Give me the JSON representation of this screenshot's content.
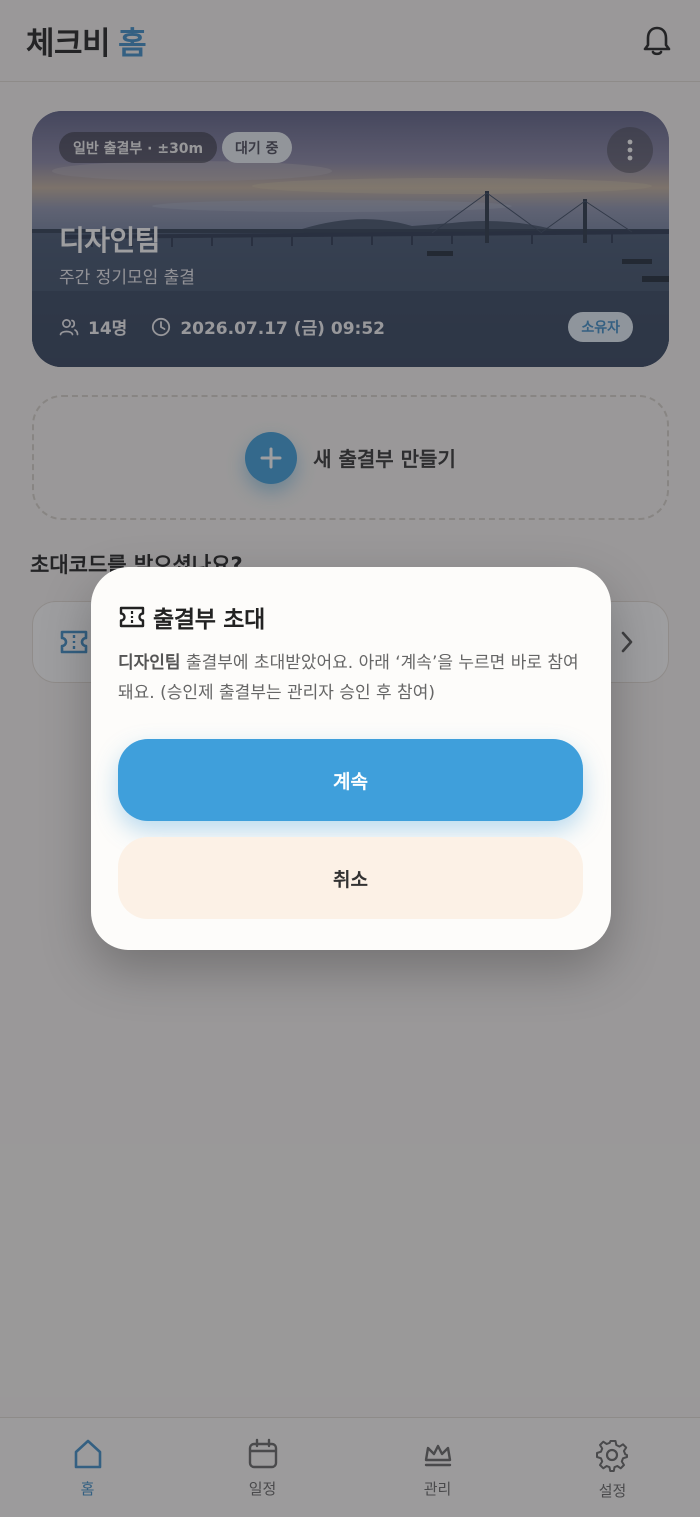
{
  "header": {
    "title": "체크비",
    "title_accent": "홈",
    "icon": "bell-icon"
  },
  "card": {
    "type_pill": "일반 출결부 · ±30m",
    "status_pill": "대기 중",
    "title": "디자인팀",
    "subtitle": "주간 정기모임 출결",
    "members": "14명",
    "datetime": "2026.07.17 (금) 09:52",
    "role_badge": "소유자"
  },
  "new_attendance": {
    "label": "새 출결부 만들기"
  },
  "invite_section": {
    "title": "초대코드를 받으셨나요?"
  },
  "modal": {
    "title": "출결부 초대",
    "body_strong": "디자인팀",
    "body_text": " 출결부에 초대받았어요. 아래 ‘계속’을 누르면 바로 참여돼요. (승인제 출결부는 관리자 승인 후 참여)",
    "continue_label": "계속",
    "cancel_label": "취소"
  },
  "bottom_nav": {
    "items": [
      {
        "label": "홈",
        "icon": "home-icon",
        "active": true
      },
      {
        "label": "일정",
        "icon": "calendar-icon",
        "active": false
      },
      {
        "label": "관리",
        "icon": "crown-icon",
        "active": false
      },
      {
        "label": "설정",
        "icon": "gear-icon",
        "active": false
      }
    ]
  },
  "colors": {
    "accent": "#3f9fdb",
    "background": "#f7f5f2",
    "cancel_bg": "#fcf1e6"
  }
}
